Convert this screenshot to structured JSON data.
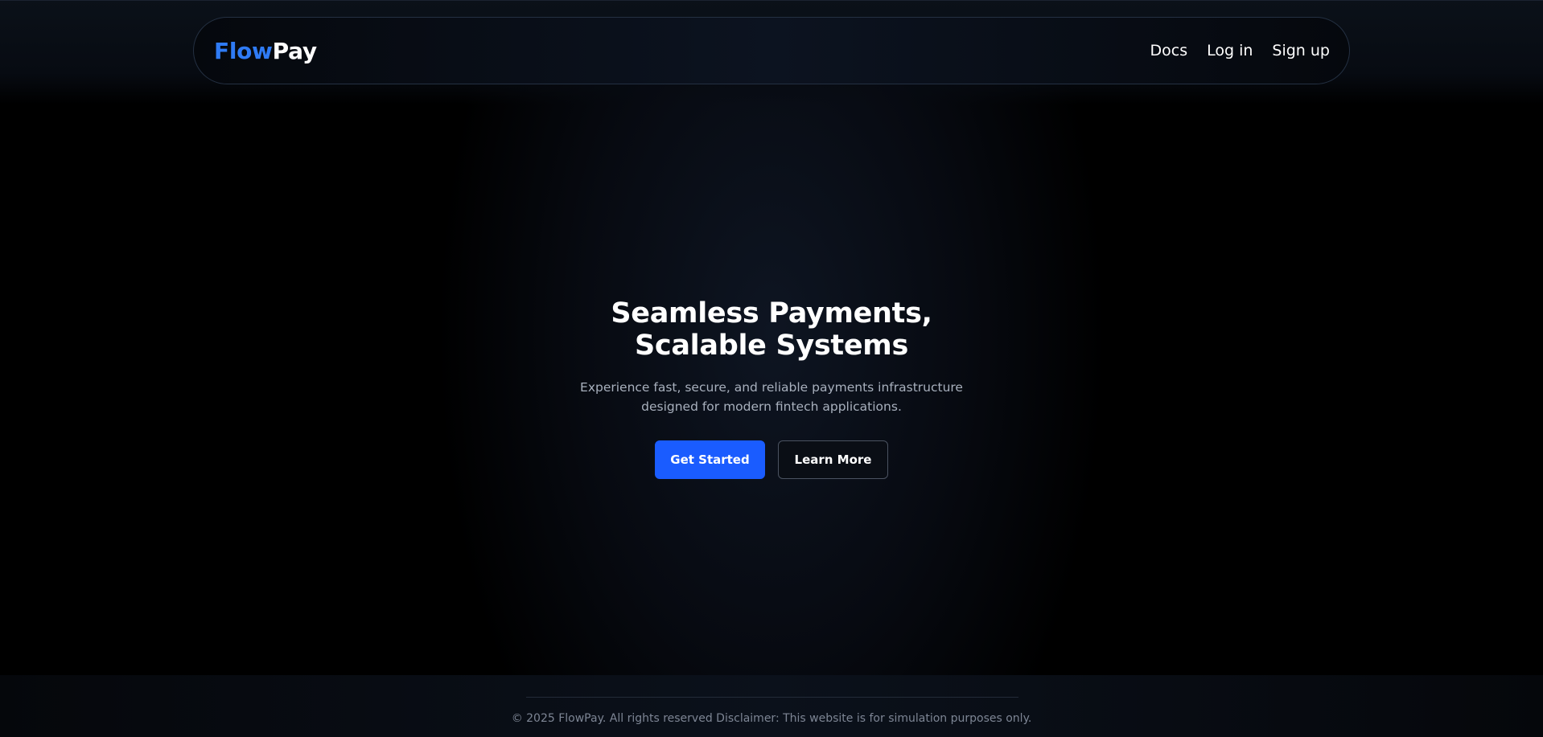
{
  "brand": {
    "logo_part1": "Flow",
    "logo_part2": "Pay",
    "accent_color": "#2f7bf5"
  },
  "nav": {
    "links": [
      {
        "label": "Docs"
      },
      {
        "label": "Log in"
      },
      {
        "label": "Sign up"
      }
    ]
  },
  "hero": {
    "title": "Seamless Payments, Scalable Systems",
    "subtitle": "Experience fast, secure, and reliable payments infrastructure designed for modern fintech applications.",
    "primary_button": "Get Started",
    "secondary_button": "Learn More",
    "primary_color": "#1a5cff"
  },
  "footer": {
    "text": "© 2025 FlowPay. All rights reserved Disclaimer: This website is for simulation purposes only."
  }
}
